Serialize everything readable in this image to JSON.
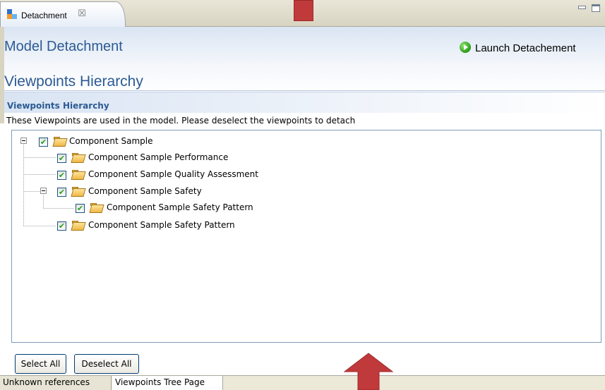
{
  "editor_tab": {
    "label": "Detachment",
    "close_icon": "☒",
    "icon": "detachment-icon"
  },
  "header": {
    "title": "Model Detachment",
    "launch_action_label": "Launch Detachement",
    "launch_icon": "green-play-icon",
    "section_title": "Viewpoints Hierarchy"
  },
  "section": {
    "heading": "Viewpoints Hierarchy",
    "description": "These Viewpoints are used in the model. Please deselect the viewpoints to detach"
  },
  "tree": {
    "items": [
      {
        "label": "Component Sample",
        "checked": true,
        "expanded": true
      },
      {
        "label": "Component Sample Performance",
        "checked": true
      },
      {
        "label": "Component Sample Quality Assessment",
        "checked": true
      },
      {
        "label": "Component Sample Safety",
        "checked": true,
        "expanded": true
      },
      {
        "label": "Component Sample Safety Pattern",
        "checked": true
      },
      {
        "label": "Component Sample Safety Pattern",
        "checked": true
      }
    ],
    "check_glyph": "✔"
  },
  "buttons": {
    "select_all": "Select All",
    "deselect_all": "Deselect All"
  },
  "page_tabs": [
    "Unknown references",
    "Viewpoints Tree Page"
  ],
  "colors": {
    "title_blue": "#2c5a93",
    "arrow_red": "#c0393b",
    "check_green": "#21a121"
  }
}
